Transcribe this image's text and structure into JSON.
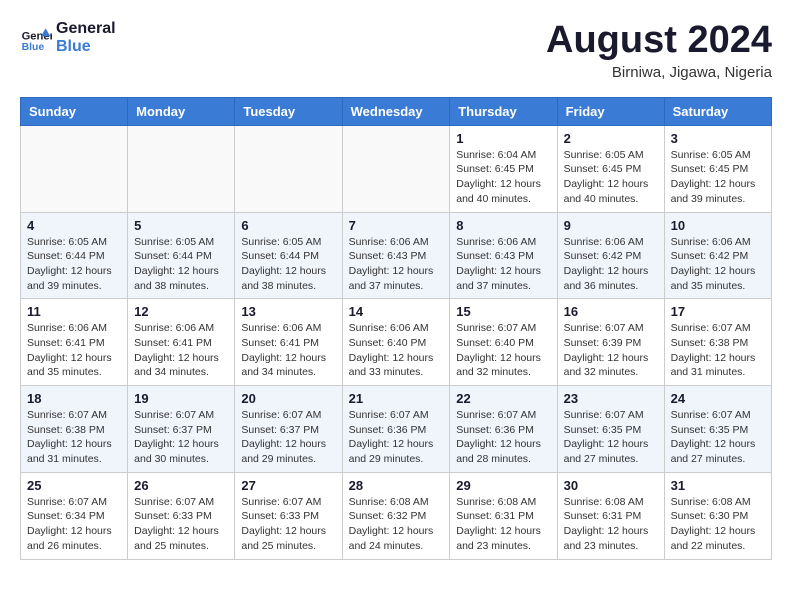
{
  "header": {
    "logo_line1": "General",
    "logo_line2": "Blue",
    "month_year": "August 2024",
    "location": "Birniwa, Jigawa, Nigeria"
  },
  "weekdays": [
    "Sunday",
    "Monday",
    "Tuesday",
    "Wednesday",
    "Thursday",
    "Friday",
    "Saturday"
  ],
  "weeks": [
    [
      {
        "day": "",
        "info": ""
      },
      {
        "day": "",
        "info": ""
      },
      {
        "day": "",
        "info": ""
      },
      {
        "day": "",
        "info": ""
      },
      {
        "day": "1",
        "info": "Sunrise: 6:04 AM\nSunset: 6:45 PM\nDaylight: 12 hours\nand 40 minutes."
      },
      {
        "day": "2",
        "info": "Sunrise: 6:05 AM\nSunset: 6:45 PM\nDaylight: 12 hours\nand 40 minutes."
      },
      {
        "day": "3",
        "info": "Sunrise: 6:05 AM\nSunset: 6:45 PM\nDaylight: 12 hours\nand 39 minutes."
      }
    ],
    [
      {
        "day": "4",
        "info": "Sunrise: 6:05 AM\nSunset: 6:44 PM\nDaylight: 12 hours\nand 39 minutes."
      },
      {
        "day": "5",
        "info": "Sunrise: 6:05 AM\nSunset: 6:44 PM\nDaylight: 12 hours\nand 38 minutes."
      },
      {
        "day": "6",
        "info": "Sunrise: 6:05 AM\nSunset: 6:44 PM\nDaylight: 12 hours\nand 38 minutes."
      },
      {
        "day": "7",
        "info": "Sunrise: 6:06 AM\nSunset: 6:43 PM\nDaylight: 12 hours\nand 37 minutes."
      },
      {
        "day": "8",
        "info": "Sunrise: 6:06 AM\nSunset: 6:43 PM\nDaylight: 12 hours\nand 37 minutes."
      },
      {
        "day": "9",
        "info": "Sunrise: 6:06 AM\nSunset: 6:42 PM\nDaylight: 12 hours\nand 36 minutes."
      },
      {
        "day": "10",
        "info": "Sunrise: 6:06 AM\nSunset: 6:42 PM\nDaylight: 12 hours\nand 35 minutes."
      }
    ],
    [
      {
        "day": "11",
        "info": "Sunrise: 6:06 AM\nSunset: 6:41 PM\nDaylight: 12 hours\nand 35 minutes."
      },
      {
        "day": "12",
        "info": "Sunrise: 6:06 AM\nSunset: 6:41 PM\nDaylight: 12 hours\nand 34 minutes."
      },
      {
        "day": "13",
        "info": "Sunrise: 6:06 AM\nSunset: 6:41 PM\nDaylight: 12 hours\nand 34 minutes."
      },
      {
        "day": "14",
        "info": "Sunrise: 6:06 AM\nSunset: 6:40 PM\nDaylight: 12 hours\nand 33 minutes."
      },
      {
        "day": "15",
        "info": "Sunrise: 6:07 AM\nSunset: 6:40 PM\nDaylight: 12 hours\nand 32 minutes."
      },
      {
        "day": "16",
        "info": "Sunrise: 6:07 AM\nSunset: 6:39 PM\nDaylight: 12 hours\nand 32 minutes."
      },
      {
        "day": "17",
        "info": "Sunrise: 6:07 AM\nSunset: 6:38 PM\nDaylight: 12 hours\nand 31 minutes."
      }
    ],
    [
      {
        "day": "18",
        "info": "Sunrise: 6:07 AM\nSunset: 6:38 PM\nDaylight: 12 hours\nand 31 minutes."
      },
      {
        "day": "19",
        "info": "Sunrise: 6:07 AM\nSunset: 6:37 PM\nDaylight: 12 hours\nand 30 minutes."
      },
      {
        "day": "20",
        "info": "Sunrise: 6:07 AM\nSunset: 6:37 PM\nDaylight: 12 hours\nand 29 minutes."
      },
      {
        "day": "21",
        "info": "Sunrise: 6:07 AM\nSunset: 6:36 PM\nDaylight: 12 hours\nand 29 minutes."
      },
      {
        "day": "22",
        "info": "Sunrise: 6:07 AM\nSunset: 6:36 PM\nDaylight: 12 hours\nand 28 minutes."
      },
      {
        "day": "23",
        "info": "Sunrise: 6:07 AM\nSunset: 6:35 PM\nDaylight: 12 hours\nand 27 minutes."
      },
      {
        "day": "24",
        "info": "Sunrise: 6:07 AM\nSunset: 6:35 PM\nDaylight: 12 hours\nand 27 minutes."
      }
    ],
    [
      {
        "day": "25",
        "info": "Sunrise: 6:07 AM\nSunset: 6:34 PM\nDaylight: 12 hours\nand 26 minutes."
      },
      {
        "day": "26",
        "info": "Sunrise: 6:07 AM\nSunset: 6:33 PM\nDaylight: 12 hours\nand 25 minutes."
      },
      {
        "day": "27",
        "info": "Sunrise: 6:07 AM\nSunset: 6:33 PM\nDaylight: 12 hours\nand 25 minutes."
      },
      {
        "day": "28",
        "info": "Sunrise: 6:08 AM\nSunset: 6:32 PM\nDaylight: 12 hours\nand 24 minutes."
      },
      {
        "day": "29",
        "info": "Sunrise: 6:08 AM\nSunset: 6:31 PM\nDaylight: 12 hours\nand 23 minutes."
      },
      {
        "day": "30",
        "info": "Sunrise: 6:08 AM\nSunset: 6:31 PM\nDaylight: 12 hours\nand 23 minutes."
      },
      {
        "day": "31",
        "info": "Sunrise: 6:08 AM\nSunset: 6:30 PM\nDaylight: 12 hours\nand 22 minutes."
      }
    ]
  ]
}
